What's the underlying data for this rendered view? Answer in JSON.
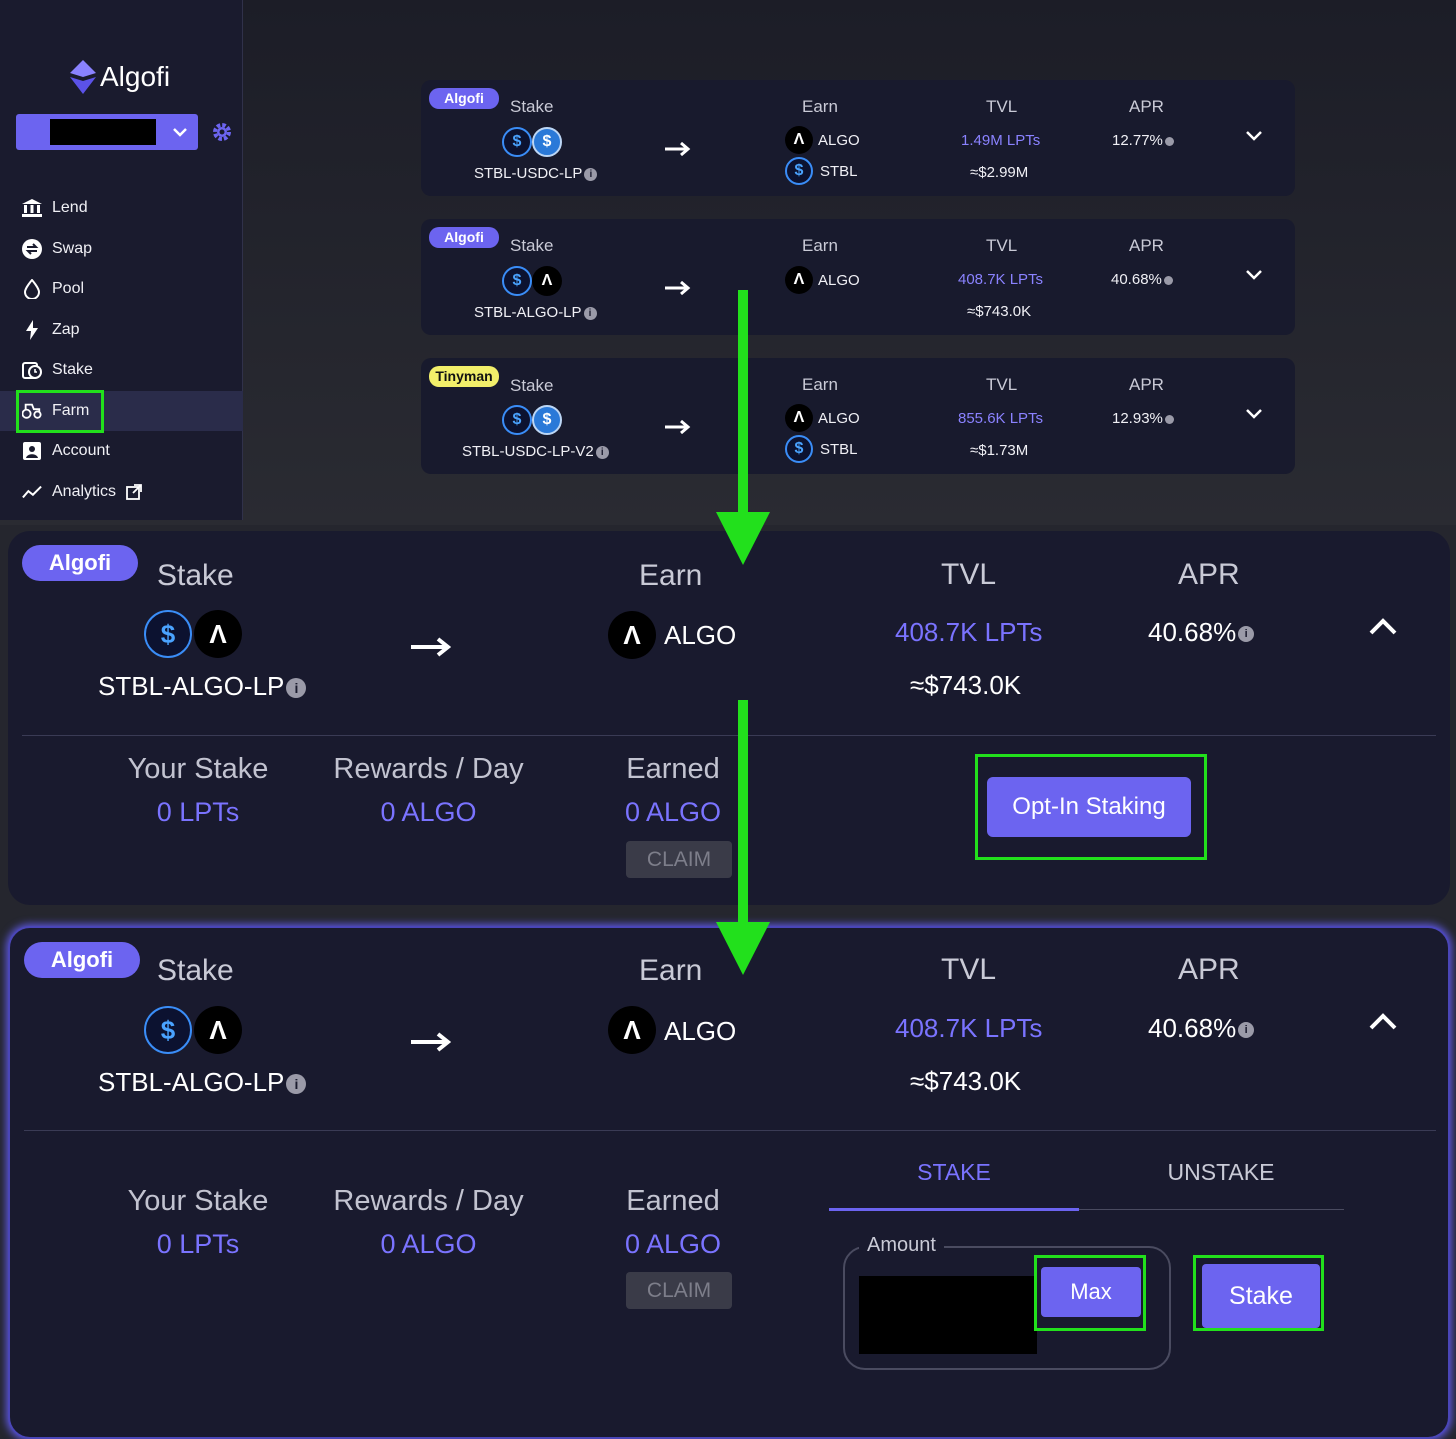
{
  "sidebar": {
    "logo_text": "Algofi",
    "nav": [
      {
        "label": "Lend",
        "icon": "bank-icon"
      },
      {
        "label": "Swap",
        "icon": "swap-icon"
      },
      {
        "label": "Pool",
        "icon": "drop-icon"
      },
      {
        "label": "Zap",
        "icon": "bolt-icon"
      },
      {
        "label": "Stake",
        "icon": "clock-icon"
      },
      {
        "label": "Farm",
        "icon": "tractor-icon",
        "active": true
      },
      {
        "label": "Account",
        "icon": "account-icon"
      },
      {
        "label": "Analytics",
        "icon": "chart-icon"
      }
    ]
  },
  "farms": [
    {
      "platform": "Algofi",
      "stake_label": "Stake",
      "pair": "STBL-USDC-LP",
      "earn_label": "Earn",
      "earn": [
        "ALGO",
        "STBL"
      ],
      "tvl_label": "TVL",
      "tvl_lpts": "1.49M LPTs",
      "tvl_usd": "≈$2.99M",
      "apr_label": "APR",
      "apr": "12.77%"
    },
    {
      "platform": "Algofi",
      "stake_label": "Stake",
      "pair": "STBL-ALGO-LP",
      "earn_label": "Earn",
      "earn": [
        "ALGO"
      ],
      "tvl_label": "TVL",
      "tvl_lpts": "408.7K LPTs",
      "tvl_usd": "≈$743.0K",
      "apr_label": "APR",
      "apr": "40.68%"
    },
    {
      "platform": "Tinyman",
      "stake_label": "Stake",
      "pair": "STBL-USDC-LP-V2",
      "earn_label": "Earn",
      "earn": [
        "ALGO",
        "STBL"
      ],
      "tvl_label": "TVL",
      "tvl_lpts": "855.6K LPTs",
      "tvl_usd": "≈$1.73M",
      "apr_label": "APR",
      "apr": "12.93%"
    }
  ],
  "expanded": {
    "platform": "Algofi",
    "stake_label": "Stake",
    "pair": "STBL-ALGO-LP",
    "earn_label": "Earn",
    "earn_token": "ALGO",
    "tvl_label": "TVL",
    "tvl_lpts": "408.7K LPTs",
    "tvl_usd": "≈$743.0K",
    "apr_label": "APR",
    "apr": "40.68%",
    "your_stake_label": "Your Stake",
    "your_stake": "0 LPTs",
    "rewards_label": "Rewards / Day",
    "rewards": "0 ALGO",
    "earned_label": "Earned",
    "earned": "0 ALGO",
    "claim_label": "CLAIM",
    "opt_in_label": "Opt-In Staking"
  },
  "stake_panel": {
    "tab_stake": "STAKE",
    "tab_unstake": "UNSTAKE",
    "amount_label": "Amount",
    "max_label": "Max",
    "stake_button": "Stake"
  },
  "colors": {
    "accent": "#6c64f0",
    "highlight": "#22e01c",
    "tvl_purple": "#7a73ff",
    "tinyman_badge": "#f2ef6a"
  }
}
